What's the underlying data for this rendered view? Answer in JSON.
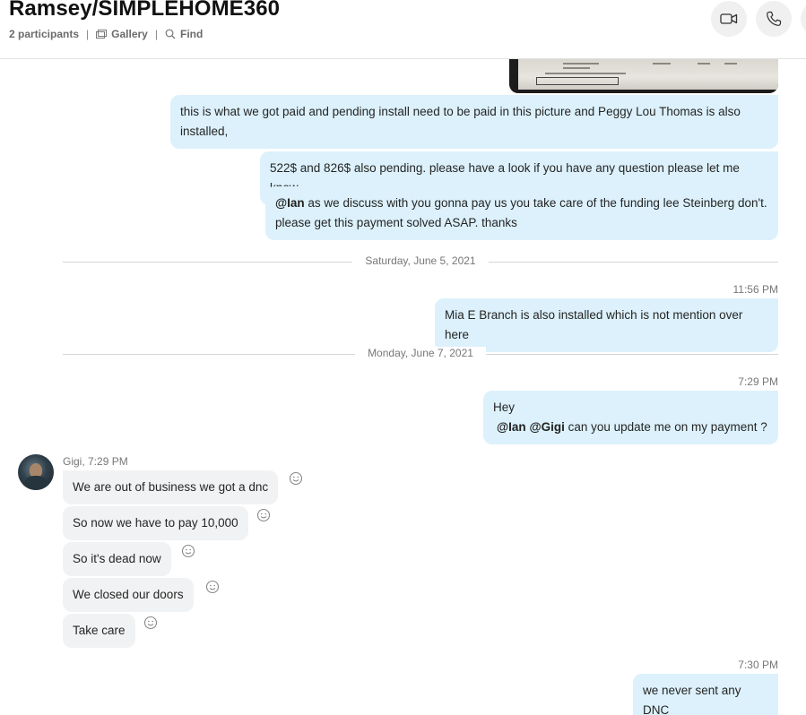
{
  "header": {
    "title": "Ramsey/SIMPLEHOME360",
    "participants": "2 participants",
    "gallery_label": "Gallery",
    "find_label": "Find",
    "separator": "|"
  },
  "messages": {
    "m1": "this is what we got paid and pending install need to be paid in this picture and Peggy Lou Thomas  is also installed,",
    "m2": "522$ and 826$ also pending. please have a look if you have any question please let me know",
    "m3_mention": "@Ian",
    "m3_text_a": " as we discuss with you  gonna pay us you take care of the funding lee Steinberg don't.",
    "m3_text_b": "please get this payment solved ASAP. thanks",
    "date1": "Saturday, June 5, 2021",
    "ts1": "11:56 PM",
    "m4": "Mia E Branch is also installed which is not mention over here",
    "date2": "Monday, June 7, 2021",
    "ts2": "7:29 PM",
    "m5_line1": "Hey",
    "m5_mention1": "@Ian",
    "m5_mention2": "@Gigi",
    "m5_text": " can you update me on my payment ?",
    "gigi_sender": "Gigi, 7:29 PM",
    "g1": "We are out of business we got a dnc",
    "g2": "So now we have to pay 10,000",
    "g3": "So it's dead now",
    "g4": "We closed our doors",
    "g5": "Take care",
    "ts3": "7:30 PM",
    "m6": "we never sent any DNC"
  },
  "icons": {
    "video": "video-call-icon",
    "call": "phone-icon",
    "gallery": "gallery-icon",
    "find": "search-icon",
    "react": "smiley-icon"
  },
  "colors": {
    "outgoing_bubble": "#dcf1fb",
    "incoming_bubble": "#f1f2f3"
  }
}
